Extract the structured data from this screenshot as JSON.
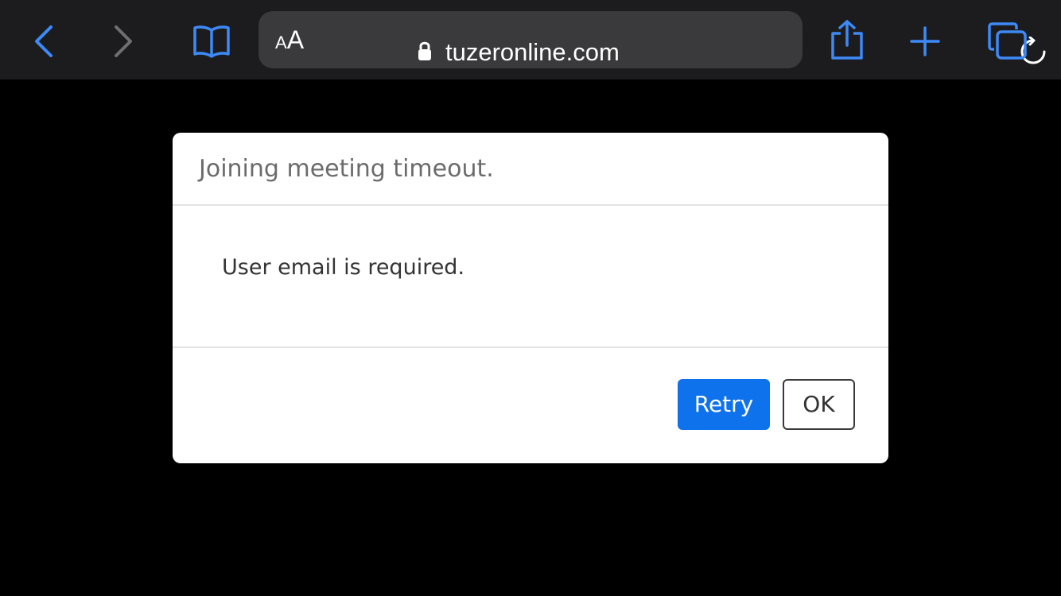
{
  "browser": {
    "address_bar": {
      "text_size_small": "A",
      "text_size_big": "A",
      "url": "tuzeronline.com"
    },
    "icons": {
      "back": "chevron-left-icon",
      "forward": "chevron-right-icon",
      "bookmarks": "book-icon",
      "lock": "lock-icon",
      "reload": "reload-icon",
      "share": "share-icon",
      "new_tab": "plus-icon",
      "tabs": "tabs-icon"
    },
    "colors": {
      "toolbar_bg": "#1c1c1e",
      "address_bg": "#3a3a3c",
      "accent": "#3d8af7",
      "disabled": "#6e6e73"
    }
  },
  "dialog": {
    "title": "Joining meeting timeout.",
    "message": "User email is required.",
    "retry_label": "Retry",
    "ok_label": "OK",
    "colors": {
      "primary": "#0e72ed"
    }
  }
}
